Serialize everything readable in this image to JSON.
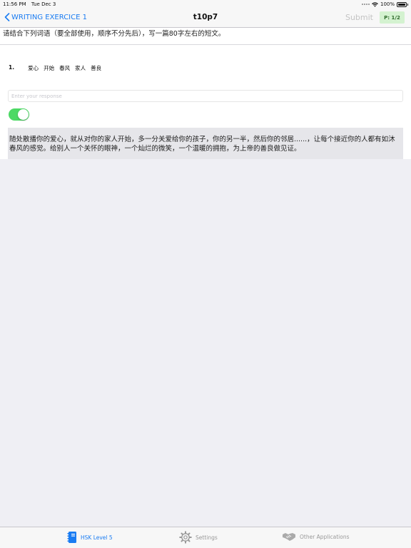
{
  "status_bar": {
    "time": "11:56 PM",
    "date": "Tue Dec 3",
    "battery": "100%"
  },
  "nav": {
    "back_label": "WRITING EXERCICE 1",
    "title": "t10p7",
    "submit_label": "Submit",
    "page_badge": "P: 1/2"
  },
  "exercise": {
    "instruction": "请结合下列词语（要全部使用，顺序不分先后），写一篇80字左右的短文。",
    "question_number": "1.",
    "words": [
      "爱心",
      "开始",
      "春风",
      "家人",
      "善良"
    ],
    "response_placeholder": "Enter your response",
    "response_value": "",
    "show_answer_toggle": true,
    "answer_text": "随处散播你的爱心，就从对你的家人开始，多一分关爱给你的孩子，你的另一半，然后你的邻居......，让每个接近你的人都有如沐春风的感觉。给别人一个关怀的眼神，一个灿烂的微笑，一个温暖的拥抱，为上帝的善良做见证。"
  },
  "tabs": [
    {
      "label": "HSK Level 5",
      "icon": "notebook-icon",
      "active": true
    },
    {
      "label": "Settings",
      "icon": "gear-icon",
      "active": false
    },
    {
      "label": "Other Applications",
      "icon": "handshake-icon",
      "active": false
    }
  ],
  "colors": {
    "accent": "#1a7cf2",
    "toggle_on": "#4cd964",
    "badge_bg": "#d4f2d0",
    "answer_bg": "#e6e6ea"
  }
}
